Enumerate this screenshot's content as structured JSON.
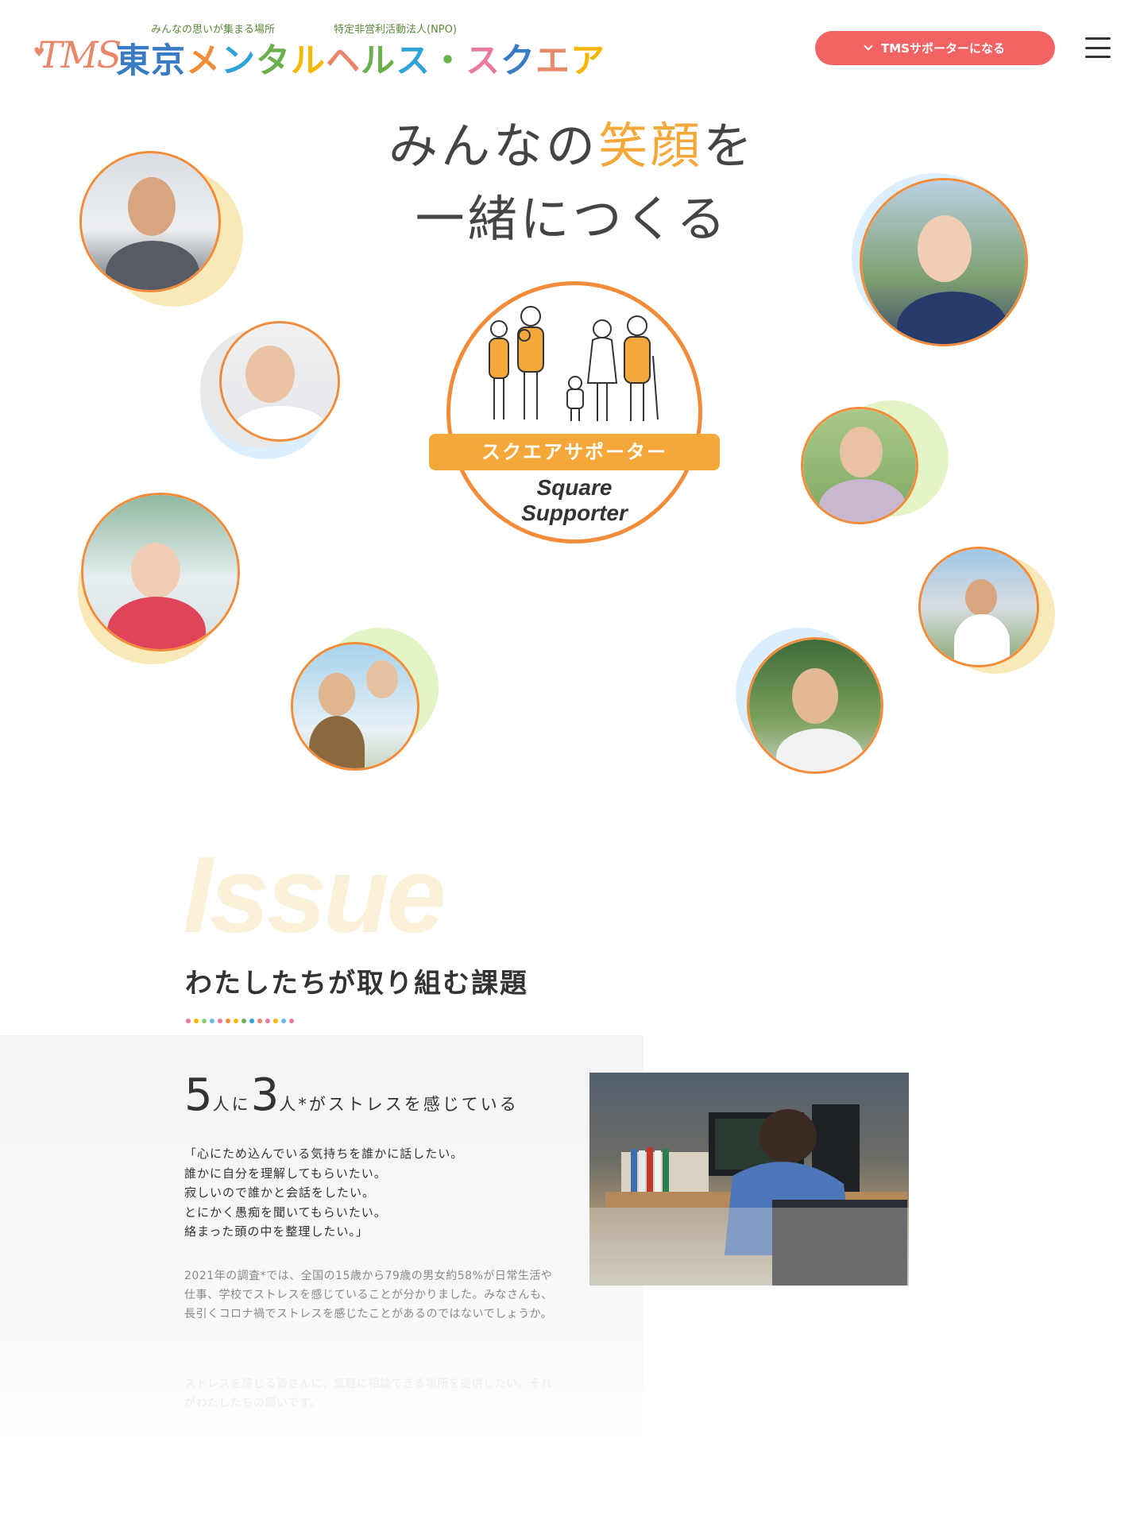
{
  "header": {
    "logo": {
      "tms": "TMS",
      "tagline": "みんなの思いが集まる場所",
      "org_type": "特定非営利活動法人(NPO)",
      "name": "東京メンタルヘルス・スクエア",
      "name_colors": [
        "#3a7cc4",
        "#3a7cc4",
        "#f28c3a",
        "#2fa3d6",
        "#6ab04c",
        "#f5b700",
        "#e8876a",
        "#6ab04c",
        "#2fa3d6",
        "#6ab04c",
        "#e87aa0",
        "#3a7cc4",
        "#e8876a",
        "#f5b700"
      ]
    },
    "cta_label": "TMSサポーターになる",
    "cta_icon": "chevron-down-icon",
    "menu_icon": "hamburger-menu-icon"
  },
  "hero": {
    "title_line1_pre": "みんなの",
    "title_line1_accent": "笑顔",
    "title_line1_post": "を",
    "title_line2": "一緒につくる",
    "emblem_label": "スクエアサポーター",
    "emblem_en_line1": "Square",
    "emblem_en_line2": "Supporter"
  },
  "issue": {
    "big_label": "Issue",
    "subtitle": "わたしたちが取り組む課題",
    "stat_num1": "5",
    "stat_mid": "人に",
    "stat_num2": "3",
    "stat_tail": "人*がストレスを感じている",
    "quote": "「心にため込んでいる気持ちを誰かに話したい。\n誰かに自分を理解してもらいたい。\n寂しいので誰かと会話をしたい。\nとにかく愚痴を聞いてもらいたい。\n絡まった頭の中を整理したい。」",
    "para1": "2021年の調査*では、全国の15歳から79歳の男女約58%が日常生活や仕事、学校でストレスを感じていることが分かりました。みなさんも、長引くコロナ禍でストレスを感じたことがあるのではないでしょうか。",
    "para2": "ストレスを感じる皆さんに、気軽に相談できる場所を提供したい。それがわたしたちの願いです。"
  },
  "colors": {
    "accent_orange": "#f5a83a",
    "ring_orange": "#f28c3a",
    "cta_red": "#f26464",
    "bubble_yellow": "#f9e9b8",
    "bubble_blue": "#dcefff",
    "bubble_green": "#e3f5c6",
    "bubble_gray": "#e9e9e9"
  }
}
